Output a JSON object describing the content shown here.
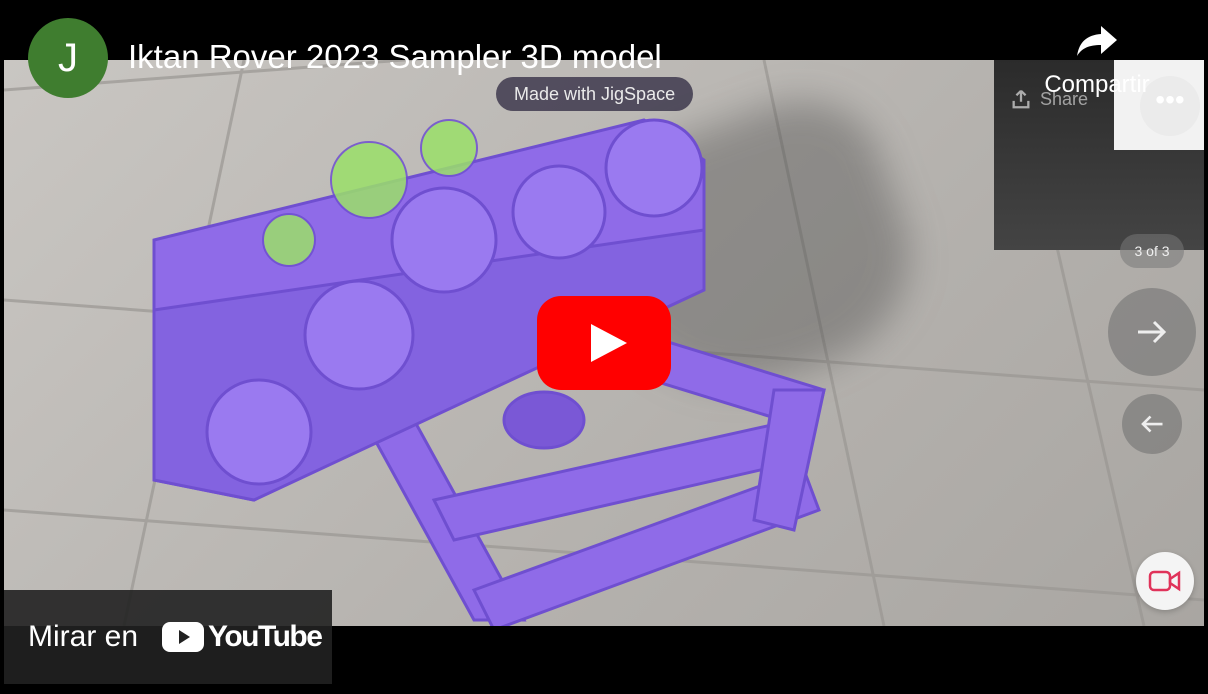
{
  "channel": {
    "avatar_letter": "J",
    "avatar_color": "#3f7d2f"
  },
  "video": {
    "title": "Iktan Rover 2023 Sampler 3D model"
  },
  "share": {
    "label": "Compartir",
    "icon": "share-arrow-icon"
  },
  "player": {
    "play_icon": "youtube-play-icon",
    "accent": "#ff0000"
  },
  "in_video": {
    "badge": "Made with JigSpace",
    "ghost_share": "Share",
    "step": "3 of 3",
    "model_color": "#8f6be8"
  },
  "watch_on": {
    "label": "Mirar en",
    "brand": "YouTube"
  }
}
